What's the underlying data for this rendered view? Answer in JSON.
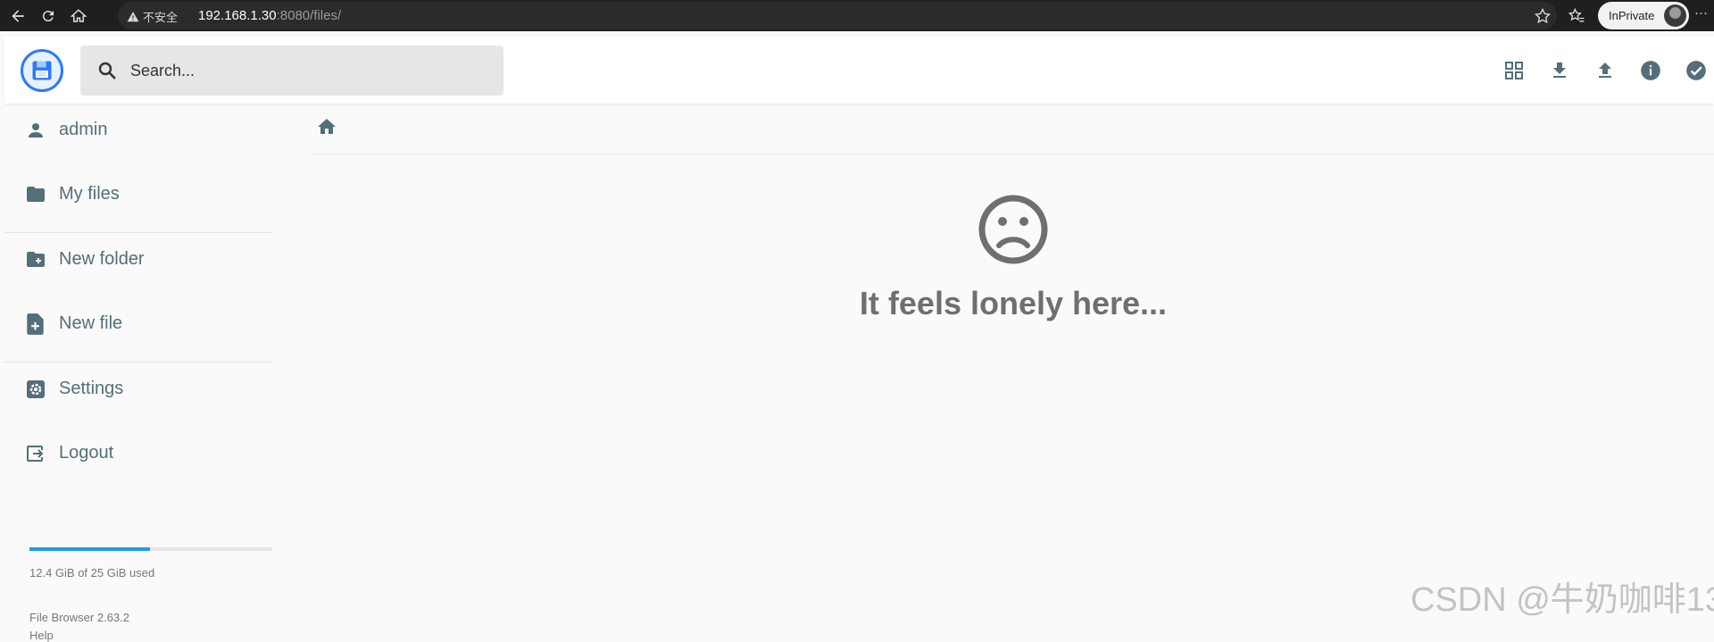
{
  "browser": {
    "security_label": "不安全",
    "url_host": "192.168.1.30",
    "url_rest": ":8080/files/",
    "inprivate_label": "InPrivate",
    "more_label": "···"
  },
  "header": {
    "search_placeholder": "Search..."
  },
  "sidebar": {
    "items": [
      {
        "label": "admin",
        "icon": "person-icon"
      },
      {
        "label": "My files",
        "icon": "folder-icon"
      },
      {
        "label": "New folder",
        "icon": "new-folder-icon"
      },
      {
        "label": "New file",
        "icon": "new-file-icon"
      },
      {
        "label": "Settings",
        "icon": "settings-icon"
      },
      {
        "label": "Logout",
        "icon": "logout-icon"
      }
    ],
    "usage": {
      "text": "12.4 GiB of 25 GiB used",
      "fraction": 0.496
    },
    "version": "File Browser 2.63.2",
    "help": "Help"
  },
  "main": {
    "empty_message": "It feels lonely here..."
  },
  "watermark": "CSDN @牛奶咖啡13",
  "colors": {
    "accent": "#2979ff",
    "usage_bar": "#2196f3",
    "nav_text": "#546e7a",
    "icon": "#546e7a"
  }
}
